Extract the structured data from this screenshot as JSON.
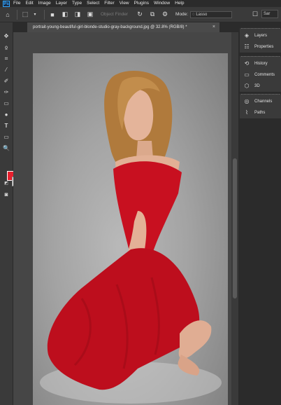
{
  "app": {
    "logo": "Ps"
  },
  "menubar": {
    "items": [
      "File",
      "Edit",
      "Image",
      "Layer",
      "Type",
      "Select",
      "Filter",
      "View",
      "Plugins",
      "Window",
      "Help"
    ]
  },
  "options": {
    "object_finder": "Object Finder",
    "mode_label": "Mode:",
    "mode_value": "Lasso",
    "sample_value": "Sar"
  },
  "document": {
    "tab_title": "portrait-young-beautiful-girl-blonde-studio-gray-background.jpg @ 32.8% (RGB/8) *",
    "close_symbol": "×"
  },
  "panels": {
    "group1": [
      {
        "icon": "layers-icon",
        "label": "Layers"
      },
      {
        "icon": "properties-icon",
        "label": "Properties"
      }
    ],
    "group2": [
      {
        "icon": "history-icon",
        "label": "History"
      },
      {
        "icon": "comments-icon",
        "label": "Comments"
      },
      {
        "icon": "3d-icon",
        "label": "3D"
      }
    ],
    "group3": [
      {
        "icon": "channels-icon",
        "label": "Channels"
      },
      {
        "icon": "paths-icon",
        "label": "Paths"
      }
    ]
  },
  "colors": {
    "foreground": "#e8202e",
    "background": "#ffffff",
    "accent": "#31a8ff"
  }
}
